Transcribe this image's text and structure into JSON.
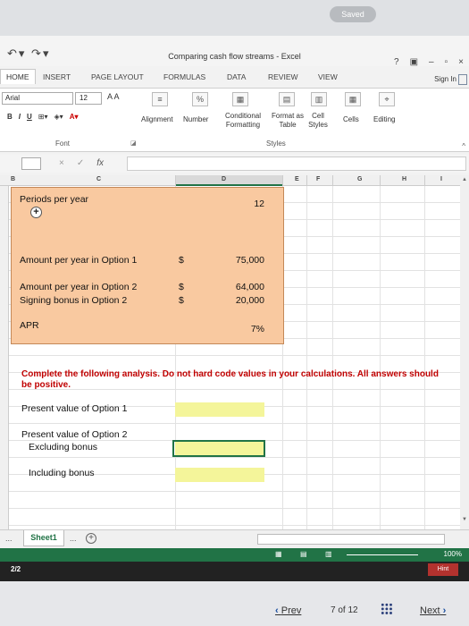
{
  "status": {
    "saved": "Saved"
  },
  "window": {
    "title": "Comparing cash flow streams - Excel",
    "help": "?",
    "min": "–",
    "restore": "▫",
    "close": "×"
  },
  "tabs": [
    "HOME",
    "INSERT",
    "PAGE LAYOUT",
    "FORMULAS",
    "DATA",
    "REVIEW",
    "VIEW"
  ],
  "signin": "Sign In",
  "ribbon": {
    "font_name": "Arial",
    "font_size": "12",
    "font_grow": "A A",
    "biu": [
      "B",
      "I",
      "U"
    ],
    "font_group": "Font",
    "alignment": "Alignment",
    "number": "Number",
    "percent": "%",
    "conditional": "Conditional Formatting",
    "format_table": "Format as Table",
    "cell_styles": "Cell Styles",
    "styles_group": "Styles",
    "cells": "Cells",
    "editing": "Editing"
  },
  "formula_bar": {
    "name_box": "",
    "fx": "fx",
    "value": ""
  },
  "columns": [
    "B",
    "C",
    "D",
    "E",
    "F",
    "G",
    "H",
    "I"
  ],
  "cells": {
    "periods_label": "Periods per year",
    "periods_value": "12",
    "amount1_label": "Amount per year in Option 1",
    "amount1_currency": "$",
    "amount1_value": "75,000",
    "amount2_label": "Amount per year in Option 2",
    "amount2_currency": "$",
    "amount2_value": "64,000",
    "bonus_label": "Signing bonus in Option 2",
    "bonus_currency": "$",
    "bonus_value": "20,000",
    "apr_label": "APR",
    "apr_value": "7%",
    "instructions": "Complete the following analysis. Do not hard code values in your calculations. All answers should be positive.",
    "pv1_label": "Present value of Option 1",
    "pv2_label": "Present value of Option 2",
    "excl_label": "Excluding bonus",
    "incl_label": "Including bonus"
  },
  "sheet_tab": "Sheet1",
  "statusbar": {
    "zoom": "100%"
  },
  "page_count": "2/2",
  "hint": "Hint",
  "nav": {
    "prev": "Prev",
    "page_of": "7 of 12",
    "next": "Next"
  },
  "colors": {
    "excel_green": "#217346",
    "input_orange": "#f9c9a0",
    "answer_yellow": "#f4f59a",
    "instruction_red": "#c00000"
  }
}
